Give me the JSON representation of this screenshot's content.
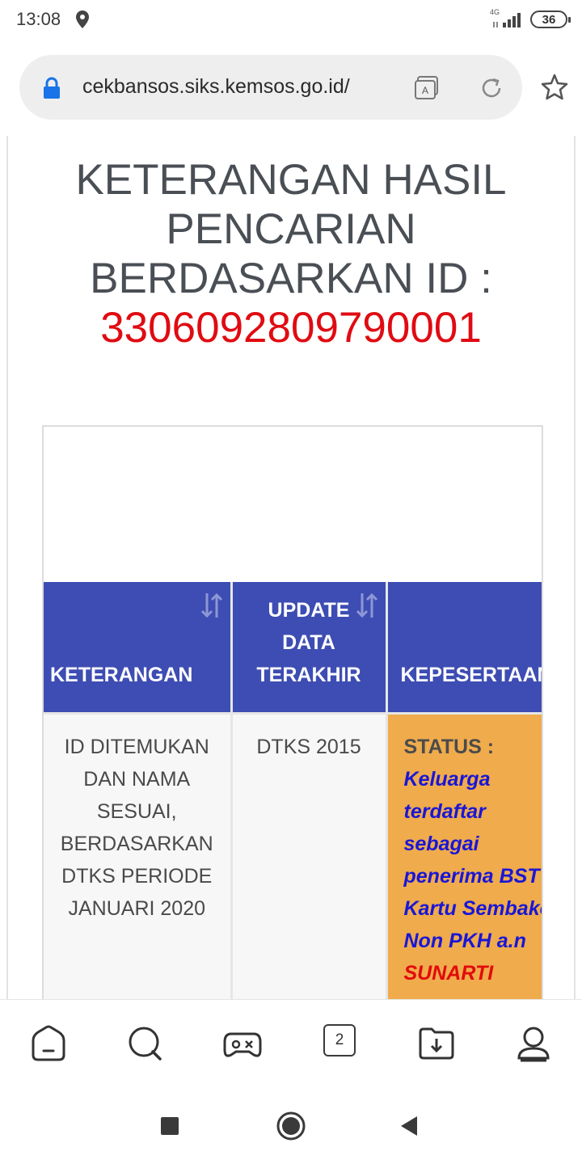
{
  "status_bar": {
    "time": "13:08",
    "network": "4G",
    "battery": "36"
  },
  "browser": {
    "url": "cekbansos.siks.kemsos.go.id/",
    "tab_count": "2"
  },
  "page": {
    "heading_lines": [
      "KETERANGAN HASIL",
      "PENCARIAN",
      "BERDASARKAN ID :"
    ],
    "search_id": "3306092809790001",
    "table": {
      "headers": {
        "keterangan": "KETERANGAN",
        "update": [
          "UPDATE",
          "DATA",
          "TERAKHIR"
        ],
        "kepesertaan": "KEPESERTAAN"
      },
      "row": {
        "keterangan_lines": [
          "ID DITEMUKAN",
          "DAN NAMA",
          "SESUAI,",
          "BERDASARKAN",
          "DTKS PERIODE",
          "JANUARI 2020"
        ],
        "update": "DTKS 2015",
        "status_label": "STATUS :",
        "status_lines": [
          "Keluarga",
          "terdaftar",
          "sebagai",
          "penerima BST",
          "Kartu Sembako",
          "Non PKH a.n"
        ],
        "status_name": "SUNARTI"
      }
    }
  },
  "colors": {
    "header_bg": "#3e4db3",
    "id_red": "#e00b12",
    "status_bg": "#efab4c",
    "status_blue": "#1a16d6"
  }
}
